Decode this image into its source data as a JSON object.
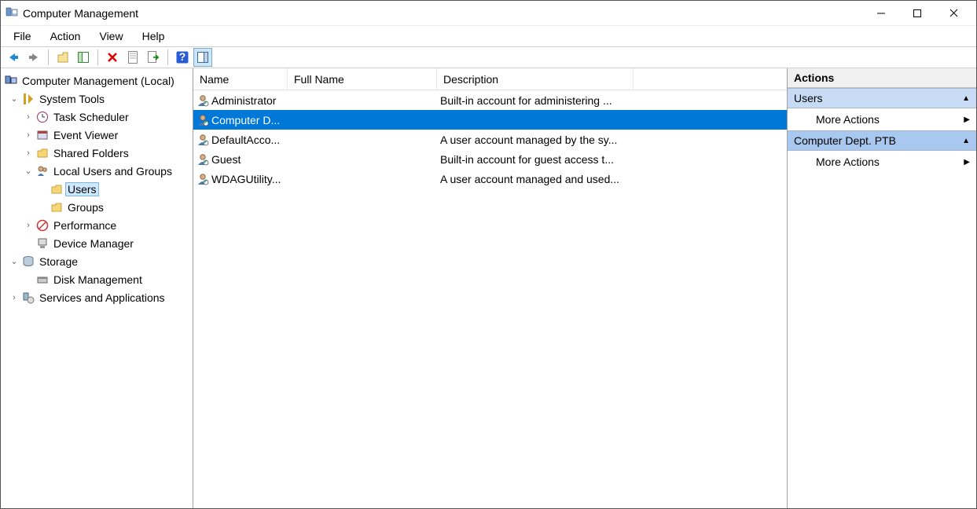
{
  "window": {
    "title": "Computer Management"
  },
  "menu": {
    "file": "File",
    "action": "Action",
    "view": "View",
    "help": "Help"
  },
  "tree_root": "Computer Management (Local)",
  "tree": {
    "system_tools": "System Tools",
    "task_scheduler": "Task Scheduler",
    "event_viewer": "Event Viewer",
    "shared_folders": "Shared Folders",
    "local_users_groups": "Local Users and Groups",
    "users": "Users",
    "groups": "Groups",
    "performance": "Performance",
    "device_manager": "Device Manager",
    "storage": "Storage",
    "disk_management": "Disk Management",
    "services_apps": "Services and Applications"
  },
  "columns": {
    "name": "Name",
    "fullname": "Full Name",
    "description": "Description"
  },
  "users_list": [
    {
      "name": "Administrator",
      "full": "",
      "desc": "Built-in account for administering ..."
    },
    {
      "name": "Computer D...",
      "full": "",
      "desc": ""
    },
    {
      "name": "DefaultAcco...",
      "full": "",
      "desc": "A user account managed by the sy..."
    },
    {
      "name": "Guest",
      "full": "",
      "desc": "Built-in account for guest access t..."
    },
    {
      "name": "WDAGUtility...",
      "full": "",
      "desc": "A user account managed and used..."
    }
  ],
  "actions": {
    "header": "Actions",
    "group1": "Users",
    "more1": "More Actions",
    "group2": "Computer Dept. PTB",
    "more2": "More Actions"
  }
}
